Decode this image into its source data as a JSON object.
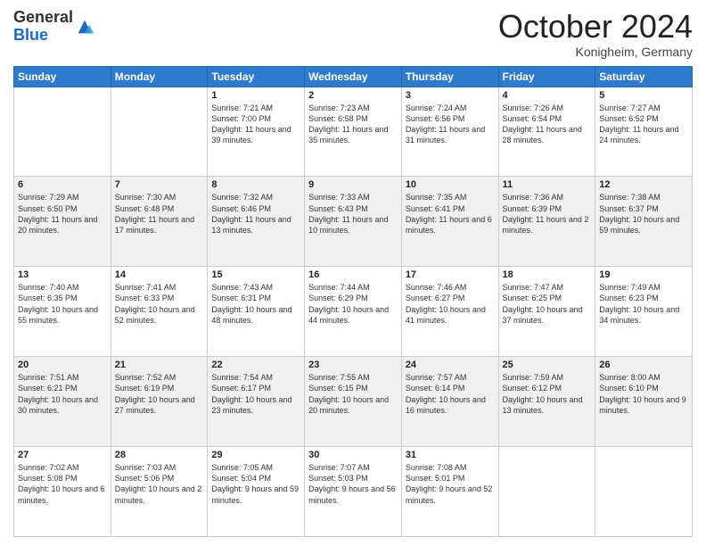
{
  "header": {
    "logo_general": "General",
    "logo_blue": "Blue",
    "month_title": "October 2024",
    "location": "Konigheim, Germany"
  },
  "weekdays": [
    "Sunday",
    "Monday",
    "Tuesday",
    "Wednesday",
    "Thursday",
    "Friday",
    "Saturday"
  ],
  "weeks": [
    [
      {
        "day": "",
        "content": ""
      },
      {
        "day": "",
        "content": ""
      },
      {
        "day": "1",
        "content": "Sunrise: 7:21 AM\nSunset: 7:00 PM\nDaylight: 11 hours and 39 minutes."
      },
      {
        "day": "2",
        "content": "Sunrise: 7:23 AM\nSunset: 6:58 PM\nDaylight: 11 hours and 35 minutes."
      },
      {
        "day": "3",
        "content": "Sunrise: 7:24 AM\nSunset: 6:56 PM\nDaylight: 11 hours and 31 minutes."
      },
      {
        "day": "4",
        "content": "Sunrise: 7:26 AM\nSunset: 6:54 PM\nDaylight: 11 hours and 28 minutes."
      },
      {
        "day": "5",
        "content": "Sunrise: 7:27 AM\nSunset: 6:52 PM\nDaylight: 11 hours and 24 minutes."
      }
    ],
    [
      {
        "day": "6",
        "content": "Sunrise: 7:29 AM\nSunset: 6:50 PM\nDaylight: 11 hours and 20 minutes."
      },
      {
        "day": "7",
        "content": "Sunrise: 7:30 AM\nSunset: 6:48 PM\nDaylight: 11 hours and 17 minutes."
      },
      {
        "day": "8",
        "content": "Sunrise: 7:32 AM\nSunset: 6:46 PM\nDaylight: 11 hours and 13 minutes."
      },
      {
        "day": "9",
        "content": "Sunrise: 7:33 AM\nSunset: 6:43 PM\nDaylight: 11 hours and 10 minutes."
      },
      {
        "day": "10",
        "content": "Sunrise: 7:35 AM\nSunset: 6:41 PM\nDaylight: 11 hours and 6 minutes."
      },
      {
        "day": "11",
        "content": "Sunrise: 7:36 AM\nSunset: 6:39 PM\nDaylight: 11 hours and 2 minutes."
      },
      {
        "day": "12",
        "content": "Sunrise: 7:38 AM\nSunset: 6:37 PM\nDaylight: 10 hours and 59 minutes."
      }
    ],
    [
      {
        "day": "13",
        "content": "Sunrise: 7:40 AM\nSunset: 6:35 PM\nDaylight: 10 hours and 55 minutes."
      },
      {
        "day": "14",
        "content": "Sunrise: 7:41 AM\nSunset: 6:33 PM\nDaylight: 10 hours and 52 minutes."
      },
      {
        "day": "15",
        "content": "Sunrise: 7:43 AM\nSunset: 6:31 PM\nDaylight: 10 hours and 48 minutes."
      },
      {
        "day": "16",
        "content": "Sunrise: 7:44 AM\nSunset: 6:29 PM\nDaylight: 10 hours and 44 minutes."
      },
      {
        "day": "17",
        "content": "Sunrise: 7:46 AM\nSunset: 6:27 PM\nDaylight: 10 hours and 41 minutes."
      },
      {
        "day": "18",
        "content": "Sunrise: 7:47 AM\nSunset: 6:25 PM\nDaylight: 10 hours and 37 minutes."
      },
      {
        "day": "19",
        "content": "Sunrise: 7:49 AM\nSunset: 6:23 PM\nDaylight: 10 hours and 34 minutes."
      }
    ],
    [
      {
        "day": "20",
        "content": "Sunrise: 7:51 AM\nSunset: 6:21 PM\nDaylight: 10 hours and 30 minutes."
      },
      {
        "day": "21",
        "content": "Sunrise: 7:52 AM\nSunset: 6:19 PM\nDaylight: 10 hours and 27 minutes."
      },
      {
        "day": "22",
        "content": "Sunrise: 7:54 AM\nSunset: 6:17 PM\nDaylight: 10 hours and 23 minutes."
      },
      {
        "day": "23",
        "content": "Sunrise: 7:55 AM\nSunset: 6:15 PM\nDaylight: 10 hours and 20 minutes."
      },
      {
        "day": "24",
        "content": "Sunrise: 7:57 AM\nSunset: 6:14 PM\nDaylight: 10 hours and 16 minutes."
      },
      {
        "day": "25",
        "content": "Sunrise: 7:59 AM\nSunset: 6:12 PM\nDaylight: 10 hours and 13 minutes."
      },
      {
        "day": "26",
        "content": "Sunrise: 8:00 AM\nSunset: 6:10 PM\nDaylight: 10 hours and 9 minutes."
      }
    ],
    [
      {
        "day": "27",
        "content": "Sunrise: 7:02 AM\nSunset: 5:08 PM\nDaylight: 10 hours and 6 minutes."
      },
      {
        "day": "28",
        "content": "Sunrise: 7:03 AM\nSunset: 5:06 PM\nDaylight: 10 hours and 2 minutes."
      },
      {
        "day": "29",
        "content": "Sunrise: 7:05 AM\nSunset: 5:04 PM\nDaylight: 9 hours and 59 minutes."
      },
      {
        "day": "30",
        "content": "Sunrise: 7:07 AM\nSunset: 5:03 PM\nDaylight: 9 hours and 56 minutes."
      },
      {
        "day": "31",
        "content": "Sunrise: 7:08 AM\nSunset: 5:01 PM\nDaylight: 9 hours and 52 minutes."
      },
      {
        "day": "",
        "content": ""
      },
      {
        "day": "",
        "content": ""
      }
    ]
  ]
}
